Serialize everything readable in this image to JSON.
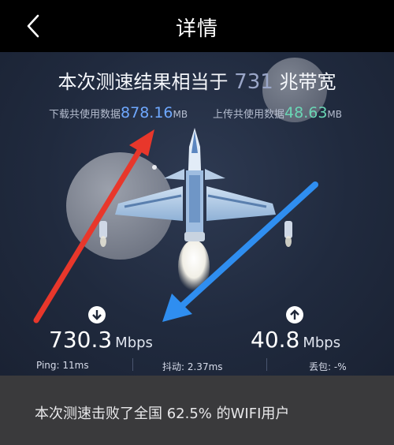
{
  "header": {
    "back_icon": "chevron-left-icon",
    "title": "详情"
  },
  "result": {
    "prefix": "本次测速结果相当于",
    "speed_value": "731",
    "suffix": "兆带宽"
  },
  "data_usage": {
    "download_label": "下载共使用数据",
    "download_value": "878.16",
    "download_unit": "MB",
    "upload_label": "上传共使用数据",
    "upload_value": "48.63",
    "upload_unit": "MB"
  },
  "download": {
    "icon": "download-arrow-icon",
    "value": "730.3",
    "unit": "Mbps"
  },
  "upload": {
    "icon": "upload-arrow-icon",
    "value": "40.8",
    "unit": "Mbps"
  },
  "metrics": {
    "ping": "Ping: 11ms",
    "jitter": "抖动: 2.37ms",
    "loss": "丢包: -%"
  },
  "footer": {
    "text": "本次测速击败了全国 62.5% 的WIFI用户"
  },
  "colors": {
    "background": "#000000",
    "stage": "#232c40",
    "download_accent": "#6fa8ff",
    "upload_accent": "#6ad6b5",
    "red_arrow": "#e8372b",
    "blue_arrow": "#2f8ef0",
    "footer_bg": "#3a3a3c"
  }
}
